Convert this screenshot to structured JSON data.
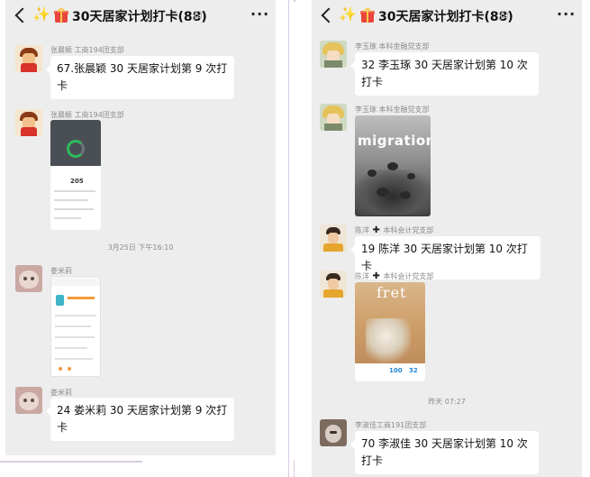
{
  "left_chat": {
    "title": "30天居家计划打卡(88)",
    "more": "···",
    "messages": [
      {
        "sender": "张晨颖  工商194团支部",
        "text": "67.张晨颖 30 天居家计划第 9 次打卡"
      },
      {
        "sender": "张晨颖  工商194团支部",
        "image": "fitness-app-screenshot",
        "image_text": "205"
      },
      {
        "timestamp": "3月25日 下午16:10"
      },
      {
        "sender": "娄米莉",
        "image": "step-app-screenshot"
      },
      {
        "sender": "娄米莉",
        "text": "24 娄米莉  30 天居家计划第 9 次打卡"
      }
    ]
  },
  "right_chat": {
    "title": "30天居家计划打卡(88)",
    "more": "···",
    "messages": [
      {
        "sender": "李玉琢 本科金融党支部",
        "text": "32 李玉琢 30 天居家计划第 10 次打卡"
      },
      {
        "sender": "李玉琢 本科金融党支部",
        "image": "migration-poster",
        "image_text": "migration"
      },
      {
        "sender": "陈洋",
        "sender_suffix": "本科会计党支部",
        "text": "19 陈洋 30 天居家计划第 10 次打卡"
      },
      {
        "sender": "陈洋",
        "sender_suffix": "本科会计党支部",
        "image": "fret-poster",
        "image_text": "fret",
        "stats": [
          "100",
          "32"
        ]
      },
      {
        "timestamp": "昨天 07:27"
      },
      {
        "sender": "李淑佳工商191团支部",
        "text": "70 李淑佳 30 天居家计划第 10 次打卡"
      }
    ]
  },
  "colors": {
    "chat_background": "#ededed",
    "bubble": "#ffffff",
    "meta_text": "#8c8c8c",
    "divider": "#d8cbe6"
  }
}
